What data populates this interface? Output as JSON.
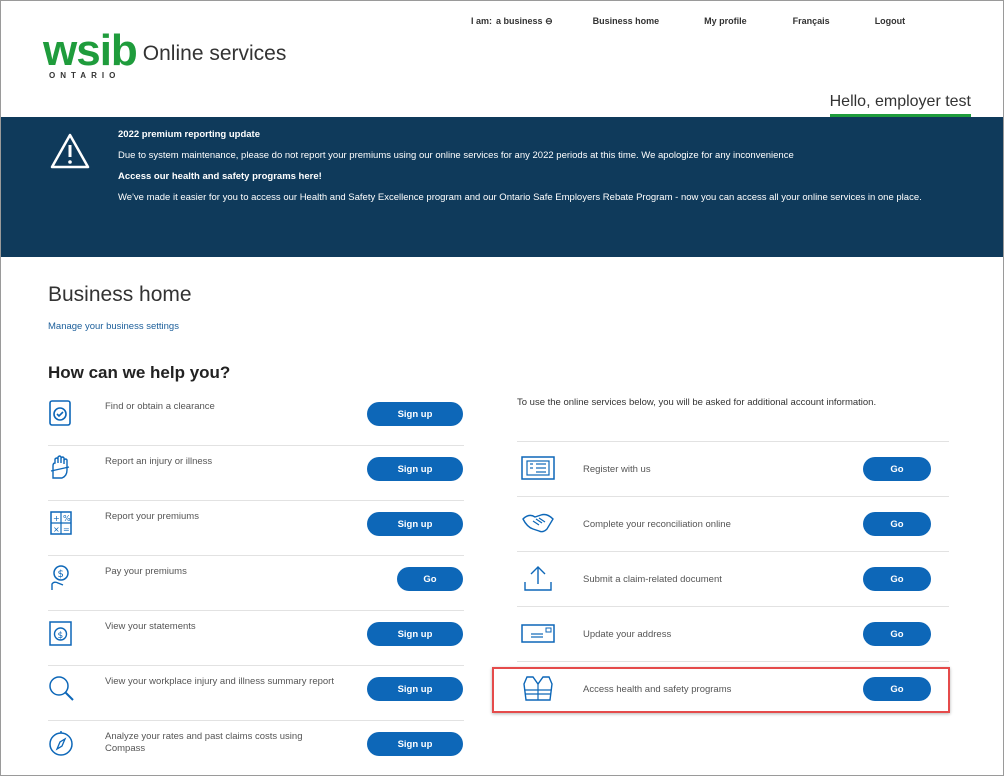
{
  "top_nav": {
    "iam_label": "I am:",
    "iam_value": "a business",
    "business_home": "Business home",
    "my_profile": "My profile",
    "francais": "Français",
    "logout": "Logout"
  },
  "logo": {
    "word": "wsib",
    "sub": "ONTARIO",
    "product": "Online services"
  },
  "greeting": "Hello, employer test",
  "banner": {
    "title1": "2022 premium reporting update",
    "text1": "Due to system maintenance, please do not report your premiums using our online services for any 2022 periods at this time. We apologize for any inconvenience",
    "title2": "Access our health and safety programs here!",
    "text2": "We've made it easier for you to access our Health and Safety Excellence program and our Ontario Safe Employers Rebate Program - now you can access all your online services in one place."
  },
  "page_title": "Business home",
  "manage_link": "Manage your business settings",
  "help_title": "How can we help you?",
  "left_services": [
    {
      "label": "Find or obtain a clearance",
      "button": "Sign up",
      "icon": "clearance-icon"
    },
    {
      "label": "Report an injury or illness",
      "button": "Sign up",
      "icon": "hand-injury-icon"
    },
    {
      "label": "Report your premiums",
      "button": "Sign up",
      "icon": "calculator-icon"
    },
    {
      "label": "Pay your premiums",
      "button": "Go",
      "icon": "pay-hand-icon"
    },
    {
      "label": "View your statements",
      "button": "Sign up",
      "icon": "statement-icon"
    },
    {
      "label": "View your workplace injury and illness summary report",
      "button": "Sign up",
      "icon": "magnifier-icon"
    },
    {
      "label": "Analyze your rates and past claims costs using Compass",
      "button": "Sign up",
      "icon": "compass-icon"
    }
  ],
  "right_intro": "To use the online services below, you will be asked for additional account information.",
  "right_services": [
    {
      "label": "Register with us",
      "button": "Go",
      "icon": "register-form-icon"
    },
    {
      "label": "Complete your reconciliation online",
      "button": "Go",
      "icon": "handshake-icon"
    },
    {
      "label": "Submit a claim-related document",
      "button": "Go",
      "icon": "upload-icon"
    },
    {
      "label": "Update your address",
      "button": "Go",
      "icon": "envelope-icon"
    },
    {
      "label": "Access health and safety programs",
      "button": "Go",
      "icon": "safety-vest-icon"
    }
  ],
  "colors": {
    "brand_green": "#1f9c3c",
    "banner_navy": "#0f3a5b",
    "button_blue": "#0d67b8",
    "highlight_red": "#e54b4b"
  }
}
